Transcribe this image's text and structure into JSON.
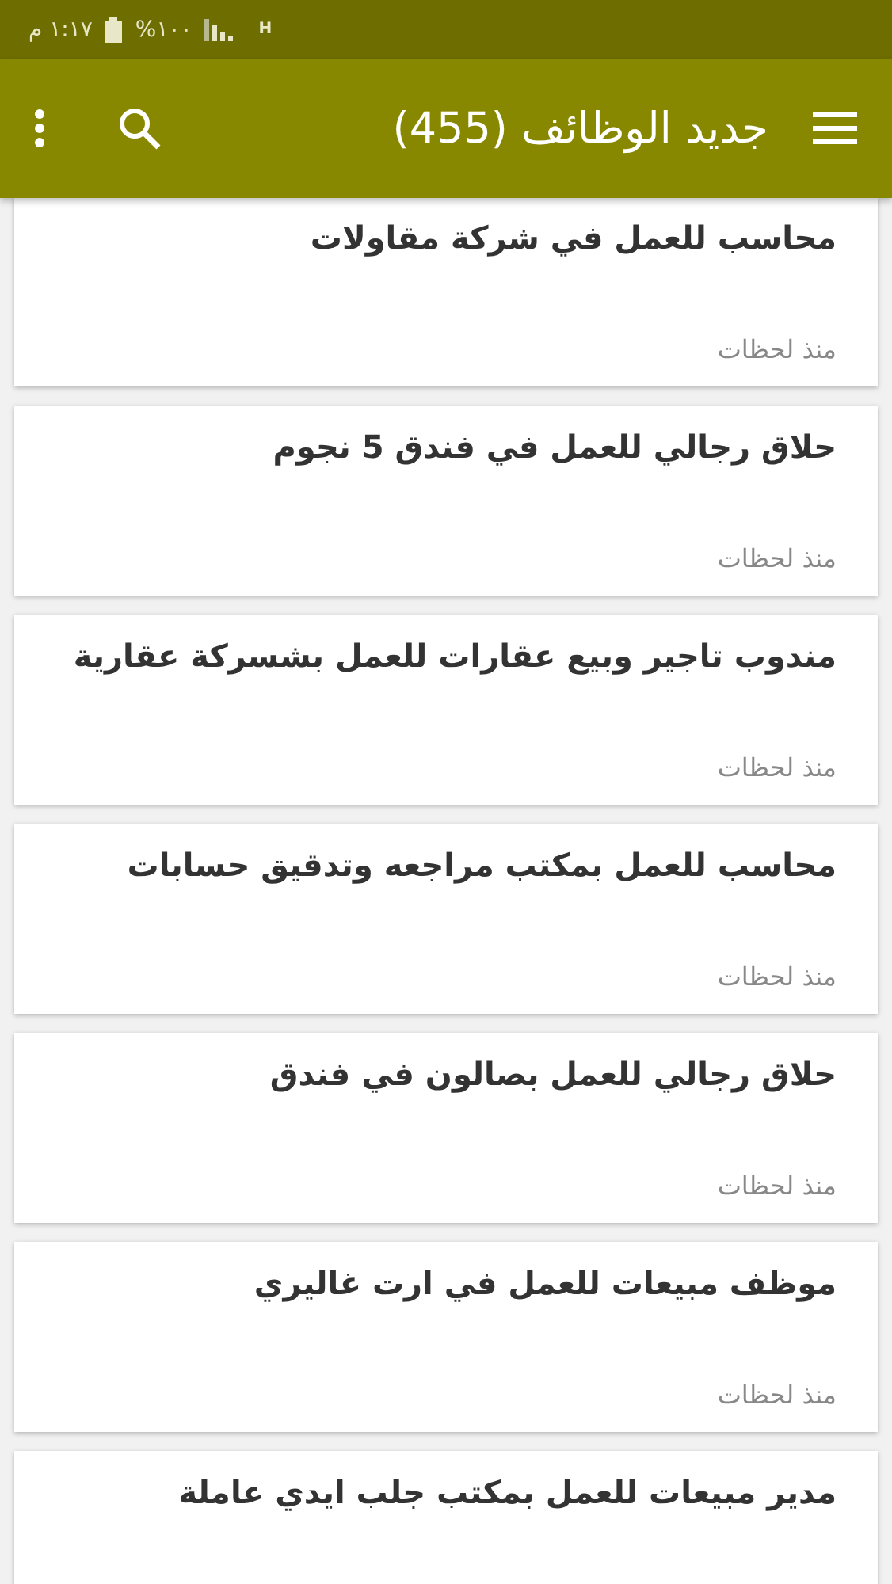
{
  "status_bar": {
    "time": "١:١٧ م",
    "battery": "١٠٠%",
    "network": "H"
  },
  "app_bar": {
    "title": "جديد الوظائف (455)"
  },
  "jobs": [
    {
      "title": "محاسب للعمل في شركة مقاولات",
      "time": "منذ لحظات"
    },
    {
      "title": "حلاق رجالي للعمل في فندق 5 نجوم",
      "time": "منذ لحظات"
    },
    {
      "title": "مندوب تاجير وبيع عقارات للعمل بشسركة عقارية",
      "time": "منذ لحظات"
    },
    {
      "title": "محاسب للعمل بمكتب مراجعه وتدقيق حسابات",
      "time": "منذ لحظات"
    },
    {
      "title": "حلاق رجالي للعمل بصالون في فندق",
      "time": "منذ لحظات"
    },
    {
      "title": "موظف مبيعات للعمل في ارت غاليري",
      "time": "منذ لحظات"
    },
    {
      "title": "مدير مبيعات للعمل بمكتب جلب ايدي عاملة"
    }
  ]
}
